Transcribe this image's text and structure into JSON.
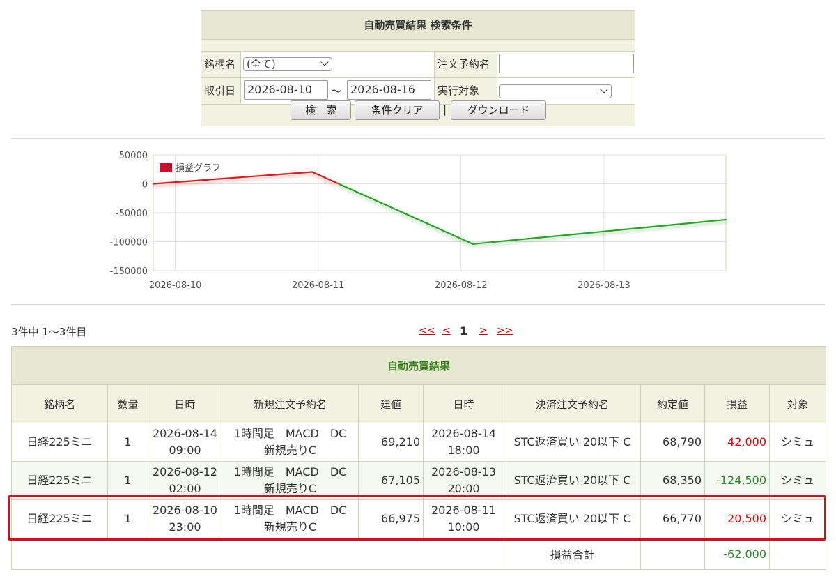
{
  "search": {
    "title": "自動売買結果 検索条件",
    "symbol_label": "銘柄名",
    "symbol_value": "(全て)",
    "order_name_label": "注文予約名",
    "order_name_value": "",
    "trade_date_label": "取引日",
    "date_from": "2026-08-10",
    "date_sep": "〜",
    "date_to": "2026-08-16",
    "target_label": "実行対象",
    "target_value": "",
    "search_button": "検　索",
    "clear_button": "条件クリア",
    "button_sep": "|",
    "download_button": "ダウンロード"
  },
  "chart_data": {
    "type": "line",
    "legend": "損益グラフ",
    "legend_position": "top-left",
    "legend_color": "#c8102e",
    "positive_color": "#cc2222",
    "negative_color": "#2aa02a",
    "grid": true,
    "x_ticks": [
      "2026-08-10",
      "2026-08-11",
      "2026-08-12",
      "2026-08-13"
    ],
    "y_ticks": [
      "50000",
      "0",
      "-50000",
      "-100000",
      "-150000"
    ],
    "ylim": [
      -150000,
      50000
    ],
    "xlim": [
      "2026-08-09 20:18",
      "2026-08-13 20:30"
    ],
    "x": [
      "2026-08-09 20:18",
      "2026-08-10 23:00",
      "2026-08-12 02:00",
      "2026-08-13 20:30"
    ],
    "values": [
      0,
      20500,
      -104000,
      -62000
    ]
  },
  "pager": {
    "count_text": "3件中 1〜3件目",
    "first": "<<",
    "prev": "<",
    "current": "1",
    "next": ">",
    "last": ">>"
  },
  "table": {
    "caption": "自動売買結果",
    "headers": [
      "銘柄名",
      "数量",
      "日時",
      "新規注文予約名",
      "建値",
      "日時",
      "決済注文予約名",
      "約定値",
      "損益",
      "対象"
    ],
    "rows": [
      {
        "symbol": "日経225ミニ",
        "qty": "1",
        "open_date": "2026-08-14",
        "open_time": "09:00",
        "order_line1": "1時間足　MACD　DC",
        "order_line2": "新規売りC",
        "entry": "69,210",
        "close_date": "2026-08-14",
        "close_time": "18:00",
        "exit_order": "STC返済買い 20以下 C",
        "fill": "68,790",
        "pl": "42,000",
        "target": "シミュ"
      },
      {
        "symbol": "日経225ミニ",
        "qty": "1",
        "open_date": "2026-08-12",
        "open_time": "02:00",
        "order_line1": "1時間足　MACD　DC",
        "order_line2": "新規売りC",
        "entry": "67,105",
        "close_date": "2026-08-13",
        "close_time": "20:00",
        "exit_order": "STC返済買い 20以下 C",
        "fill": "68,350",
        "pl": "-124,500",
        "target": "シミュ"
      },
      {
        "symbol": "日経225ミニ",
        "qty": "1",
        "open_date": "2026-08-10",
        "open_time": "23:00",
        "order_line1": "1時間足　MACD　DC",
        "order_line2": "新規売りC",
        "entry": "66,975",
        "close_date": "2026-08-11",
        "close_time": "10:00",
        "exit_order": "STC返済買い 20以下 C",
        "fill": "66,770",
        "pl": "20,500",
        "target": "シミュ"
      }
    ],
    "total_label": "損益合計",
    "total_value": "-62,000"
  }
}
